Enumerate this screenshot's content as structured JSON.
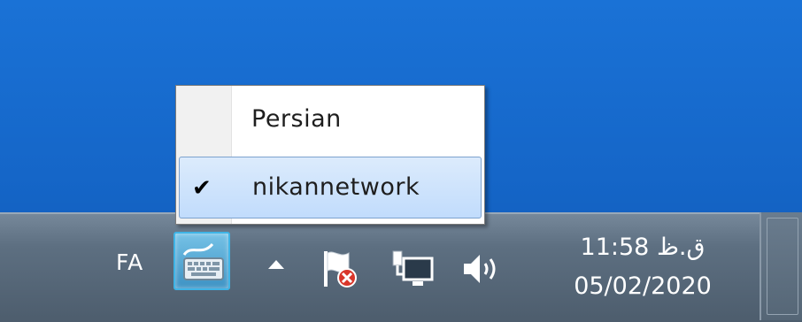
{
  "taskbar": {
    "language_indicator": "FA",
    "tray_icons": [
      "keyboard-icon",
      "show-hidden-icons-arrow",
      "action-center-flag-icon",
      "network-icon",
      "volume-icon"
    ],
    "clock": {
      "time": "11:58 ق.ظ",
      "date": "05/02/2020"
    }
  },
  "language_menu": {
    "items": [
      {
        "label": "Persian",
        "checked": false,
        "selected": false
      },
      {
        "label": "nikannetwork",
        "checked": true,
        "selected": true
      }
    ],
    "check_mark": "✔"
  },
  "colors": {
    "desktop_blue": "#1566c8",
    "taskbar": "#5d6f81",
    "menu_highlight": "#c1dcfc",
    "error_badge": "#d9362a"
  }
}
